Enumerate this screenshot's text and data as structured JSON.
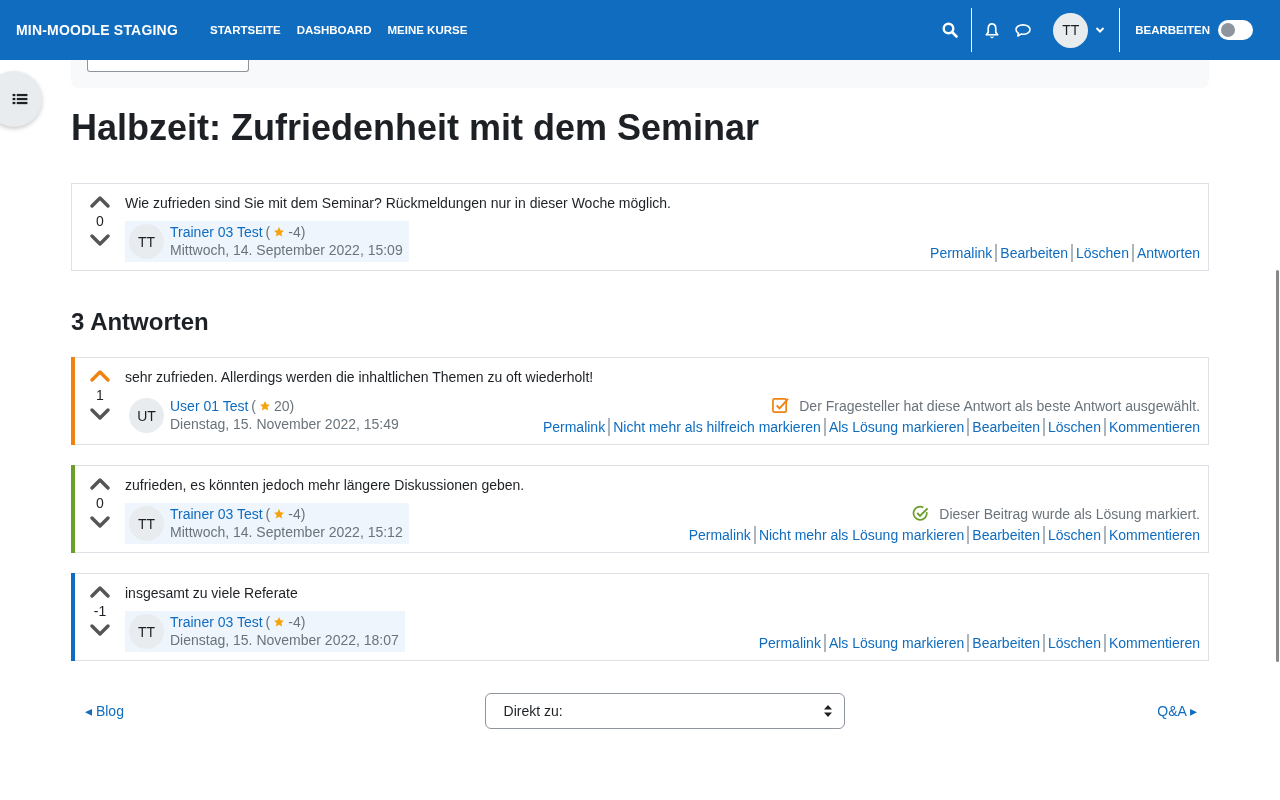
{
  "header": {
    "brand": "MIN-MOODLE STAGING",
    "nav": [
      {
        "label": "STARTSEITE"
      },
      {
        "label": "DASHBOARD"
      },
      {
        "label": "MEINE KURSE"
      }
    ],
    "avatar": "TT",
    "edit_label": "BEARBEITEN",
    "edit_on": false
  },
  "title": "Halbzeit: Zufriedenheit mit dem Seminar",
  "question": {
    "upvoted": false,
    "votes": "0",
    "text": "Wie zufrieden sind Sie mit dem Seminar? Rückmeldungen nur in dieser Woche möglich.",
    "initials": "TT",
    "author": "Trainer 03 Test",
    "rating_open": "(",
    "rating": "-4)",
    "date": "Mittwoch, 14. September 2022, 15:09",
    "author_highlighted": true,
    "links": [
      "Permalink",
      "Bearbeiten",
      "Löschen",
      "Antworten"
    ]
  },
  "answers_heading": "3 Antworten",
  "replies": [
    {
      "color": "#f0820f",
      "upvoted": true,
      "votes": "1",
      "text": "sehr zufrieden. Allerdings werden die inhaltlichen Themen zu oft wiederholt!",
      "initials": "UT",
      "author": "User 01 Test",
      "rating_open": "(",
      "rating": "20)",
      "date": "Dienstag, 15. November 2022, 15:49",
      "author_highlighted": false,
      "status": {
        "kind": "best",
        "text": "Der Fragesteller hat diese Antwort als beste Antwort ausgewählt."
      },
      "links": [
        "Permalink",
        "Nicht mehr als hilfreich markieren",
        "Als Lösung markieren",
        "Bearbeiten",
        "Löschen",
        "Kommentieren"
      ]
    },
    {
      "color": "#6a9f2a",
      "upvoted": false,
      "votes": "0",
      "text": "zufrieden, es könnten jedoch mehr längere Diskussionen geben.",
      "initials": "TT",
      "author": "Trainer 03 Test",
      "rating_open": "(",
      "rating": "-4)",
      "date": "Mittwoch, 14. September 2022, 15:12",
      "author_highlighted": true,
      "status": {
        "kind": "solution",
        "text": "Dieser Beitrag wurde als Lösung markiert."
      },
      "links": [
        "Permalink",
        "Nicht mehr als Lösung markieren",
        "Bearbeiten",
        "Löschen",
        "Kommentieren"
      ]
    },
    {
      "color": "#0f6cbf",
      "upvoted": false,
      "votes": "-1",
      "text": "insgesamt zu viele Referate",
      "initials": "TT",
      "author": "Trainer 03 Test",
      "rating_open": "(",
      "rating": "-4)",
      "date": "Dienstag, 15. November 2022, 18:07",
      "author_highlighted": true,
      "links": [
        "Permalink",
        "Als Lösung markieren",
        "Bearbeiten",
        "Löschen",
        "Kommentieren"
      ]
    }
  ],
  "footer": {
    "prev": "◂ Blog",
    "jump_placeholder": "Direkt zu:",
    "next": "Q&A ▸"
  }
}
